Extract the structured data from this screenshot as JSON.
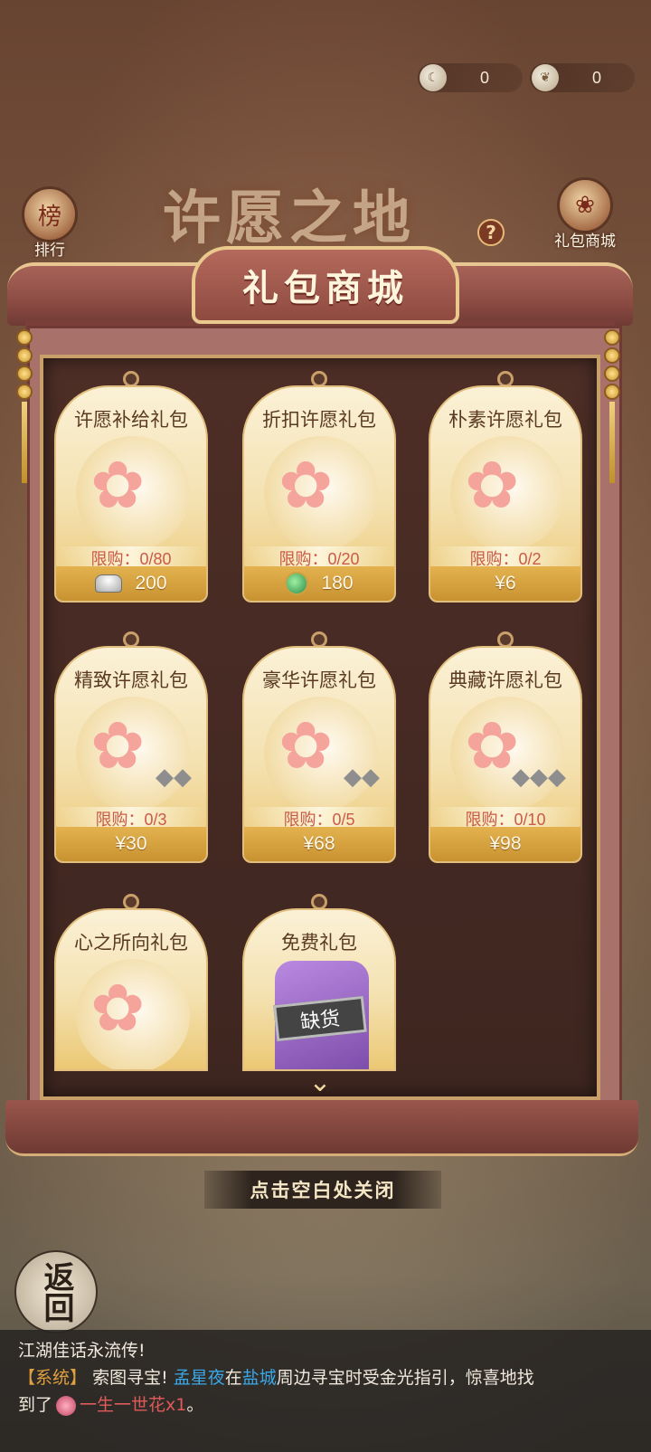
{
  "currencies": [
    {
      "icon": "silver-moon-icon",
      "value": "0"
    },
    {
      "icon": "gold-leaf-icon",
      "value": "0"
    }
  ],
  "background": {
    "title": "许愿之地",
    "left_button": {
      "icon": "ranking-scroll-icon",
      "label": "排行",
      "glyph": "榜"
    },
    "right_button": {
      "icon": "gift-bag-icon",
      "label": "礼包商城"
    },
    "help": "?"
  },
  "modal": {
    "title": "礼包商城",
    "scroll_down": "⌄",
    "close_hint": "点击空白处关闭"
  },
  "packs": [
    {
      "name": "许愿补给礼包",
      "limit": "限购：0/80",
      "price": "200",
      "currency": "silver-ingot-icon"
    },
    {
      "name": "折扣许愿礼包",
      "limit": "限购：0/20",
      "price": "180",
      "currency": "jade-dragon-coin-icon"
    },
    {
      "name": "朴素许愿礼包",
      "limit": "限购：0/2",
      "price": "¥6"
    },
    {
      "name": "精致许愿礼包",
      "limit": "限购：0/3",
      "price": "¥30"
    },
    {
      "name": "豪华许愿礼包",
      "limit": "限购：0/5",
      "price": "¥68"
    },
    {
      "name": "典藏许愿礼包",
      "limit": "限购：0/10",
      "price": "¥98"
    },
    {
      "name": "心之所向礼包"
    },
    {
      "name": "免费礼包",
      "status": "缺货"
    }
  ],
  "back": {
    "label": "返回"
  },
  "chat": {
    "line1": "江湖佳话永流传!",
    "tag": "【系统】",
    "msg1": "索图寻宝!",
    "player": "孟星夜",
    "at": "在",
    "place": "盐城",
    "msg2": "周边寻宝时受金光指引，惊喜地找",
    "msg3": "到了",
    "item": "一生一世花x1",
    "end": "。"
  },
  "colors": {
    "accent": "#c95a4a",
    "gold": "#e3b24f",
    "frame": "#8c4c44"
  }
}
